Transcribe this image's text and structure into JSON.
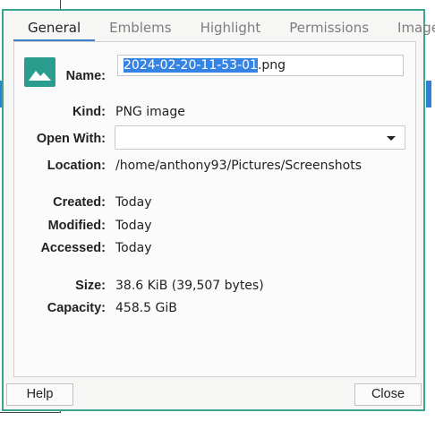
{
  "tabs": [
    {
      "label": "General"
    },
    {
      "label": "Emblems"
    },
    {
      "label": "Highlight"
    },
    {
      "label": "Permissions"
    },
    {
      "label": "Image"
    }
  ],
  "general": {
    "name_label": "Name:",
    "name_selected": "2024-02-20-11-53-01",
    "name_ext": ".png",
    "kind_label": "Kind:",
    "kind_value": "PNG image",
    "open_with_label": "Open With:",
    "open_with_value": "",
    "location_label": "Location:",
    "location_value": "/home/anthony93/Pictures/Screenshots",
    "created_label": "Created:",
    "created_value": "Today",
    "modified_label": "Modified:",
    "modified_value": "Today",
    "accessed_label": "Accessed:",
    "accessed_value": "Today",
    "size_label": "Size:",
    "size_value": "38.6 KiB (39,507 bytes)",
    "capacity_label": "Capacity:",
    "capacity_value": "458.5 GiB"
  },
  "footer": {
    "help_label": "Help",
    "close_label": "Close"
  },
  "icons": {
    "file_icon": "image-file-icon",
    "dropdown_icon": "chevron-down-icon"
  },
  "colors": {
    "accent": "#3aa58c",
    "selection": "#3584e4",
    "tab_active_underline": "#3d83c9",
    "file_icon_bg": "#2a9d8f"
  }
}
